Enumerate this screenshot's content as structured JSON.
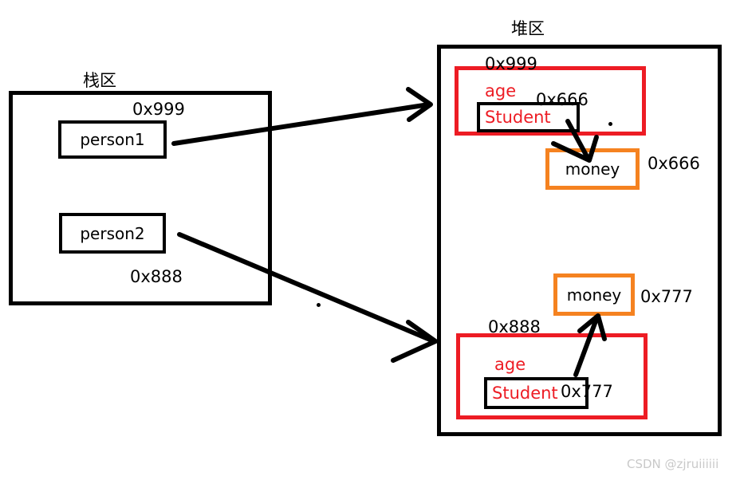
{
  "diagram": {
    "title_stack": "栈区",
    "title_heap": "堆区",
    "watermark": "CSDN @zjruiiiiii"
  },
  "stack": {
    "label": "栈区",
    "variables": [
      {
        "name": "person1",
        "address": "0x999"
      },
      {
        "name": "person2",
        "address": "0x888"
      }
    ]
  },
  "heap": {
    "label": "堆区",
    "objects": [
      {
        "address": "0x999",
        "field_label": "age",
        "type_label": "Student",
        "pointer_value": "0x666"
      },
      {
        "address": "0x888",
        "field_label": "age",
        "type_label": "Student",
        "pointer_value": "0x777"
      }
    ],
    "money_blocks": [
      {
        "name": "money",
        "address": "0x666"
      },
      {
        "name": "money",
        "address": "0x777"
      }
    ]
  },
  "colors": {
    "object_border": "#ED1C24",
    "money_border": "#F58220",
    "frame": "#000000",
    "arrow": "#000000",
    "watermark": "#c9c9c9"
  }
}
